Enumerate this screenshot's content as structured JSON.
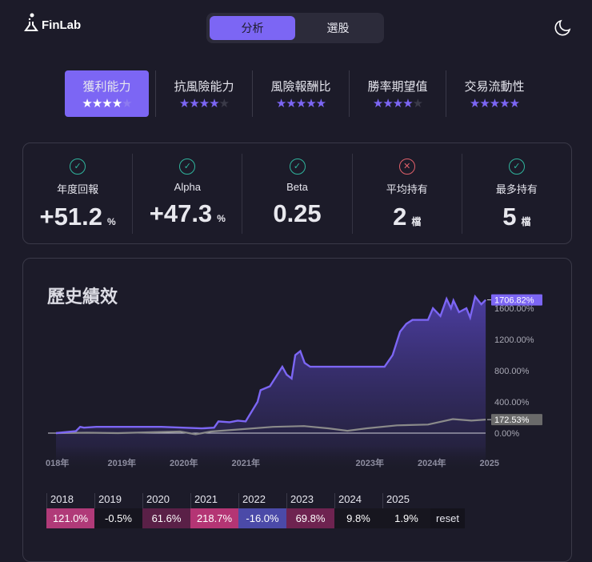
{
  "header": {
    "brand": "FinLab",
    "modes": [
      "分析",
      "選股"
    ],
    "active_mode": 0
  },
  "tabs": [
    {
      "label": "獲利能力",
      "stars": 4
    },
    {
      "label": "抗風險能力",
      "stars": 4
    },
    {
      "label": "風險報酬比",
      "stars": 5
    },
    {
      "label": "勝率期望值",
      "stars": 4
    },
    {
      "label": "交易流動性",
      "stars": 5
    }
  ],
  "metrics": [
    {
      "label": "年度回報",
      "value": "+51.2",
      "unit": "%",
      "pass": true
    },
    {
      "label": "Alpha",
      "value": "+47.3",
      "unit": "%",
      "pass": true
    },
    {
      "label": "Beta",
      "value": "0.25",
      "unit": "",
      "pass": true
    },
    {
      "label": "平均持有",
      "value": "2",
      "unit": "檔",
      "pass": false
    },
    {
      "label": "最多持有",
      "value": "5",
      "unit": "檔",
      "pass": true
    }
  ],
  "performance": {
    "title": "歷史績效",
    "reset_label": "reset",
    "yearly": [
      {
        "year": "2018",
        "value": "121.0%",
        "color": "#b03a78"
      },
      {
        "year": "2019",
        "value": "-0.5%",
        "color": "#16151f"
      },
      {
        "year": "2020",
        "value": "61.6%",
        "color": "#5a2047"
      },
      {
        "year": "2021",
        "value": "218.7%",
        "color": "#b43574"
      },
      {
        "year": "2022",
        "value": "-16.0%",
        "color": "#4b4aa8"
      },
      {
        "year": "2023",
        "value": "69.8%",
        "color": "#6e2350"
      },
      {
        "year": "2024",
        "value": "9.8%",
        "color": "#17161f"
      },
      {
        "year": "2025",
        "value": "1.9%",
        "color": "#17161f"
      }
    ]
  },
  "chart_data": {
    "type": "area",
    "title": "歷史績效",
    "x_ticks": [
      "018年",
      "2019年",
      "2020年",
      "2021年",
      "2023年",
      "2024年",
      "2025"
    ],
    "x_tick_years": [
      2018,
      2019,
      2020,
      2021,
      2023,
      2024,
      2025
    ],
    "y_ticks": [
      "0.00%",
      "400.00%",
      "800.00%",
      "1200.00%",
      "1600.00%"
    ],
    "y_tick_values": [
      0,
      400,
      800,
      1200,
      1600
    ],
    "series": [
      {
        "name": "strategy",
        "color": "#7c66f4",
        "last_label": "1706.82%",
        "x": [
          2018.0,
          2018.13,
          2018.32,
          2018.39,
          2018.45,
          2018.65,
          2019.7,
          2020.35,
          2020.55,
          2020.62,
          2020.8,
          2020.93,
          2021.06,
          2021.25,
          2021.3,
          2021.45,
          2021.65,
          2021.72,
          2021.8,
          2021.86,
          2021.94,
          2022.01,
          2022.1,
          2022.2,
          2023.3,
          2023.43,
          2023.55,
          2023.65,
          2023.75,
          2024.0,
          2024.08,
          2024.2,
          2024.3,
          2024.37,
          2024.41,
          2024.5,
          2024.62,
          2024.68,
          2024.76,
          2024.86,
          2024.93
        ],
        "y": [
          0,
          10,
          25,
          80,
          70,
          80,
          80,
          60,
          70,
          150,
          140,
          160,
          150,
          400,
          550,
          600,
          850,
          750,
          700,
          1000,
          1050,
          900,
          850,
          850,
          850,
          1000,
          1300,
          1400,
          1450,
          1450,
          1600,
          1500,
          1720,
          1600,
          1700,
          1550,
          1600,
          1480,
          1750,
          1650,
          1707
        ]
      },
      {
        "name": "benchmark",
        "color": "#8a8a8a",
        "last_label": "172.53%",
        "x": [
          2018.0,
          2018.5,
          2019.0,
          2019.5,
          2020.0,
          2020.25,
          2020.5,
          2021.0,
          2021.5,
          2022.0,
          2022.4,
          2022.7,
          2023.0,
          2023.5,
          2024.0,
          2024.4,
          2024.7,
          2024.93
        ],
        "y": [
          0,
          5,
          0,
          10,
          20,
          -15,
          20,
          50,
          80,
          90,
          60,
          30,
          60,
          100,
          110,
          180,
          160,
          173
        ]
      }
    ],
    "ylim": [
      -200,
      1800
    ]
  }
}
